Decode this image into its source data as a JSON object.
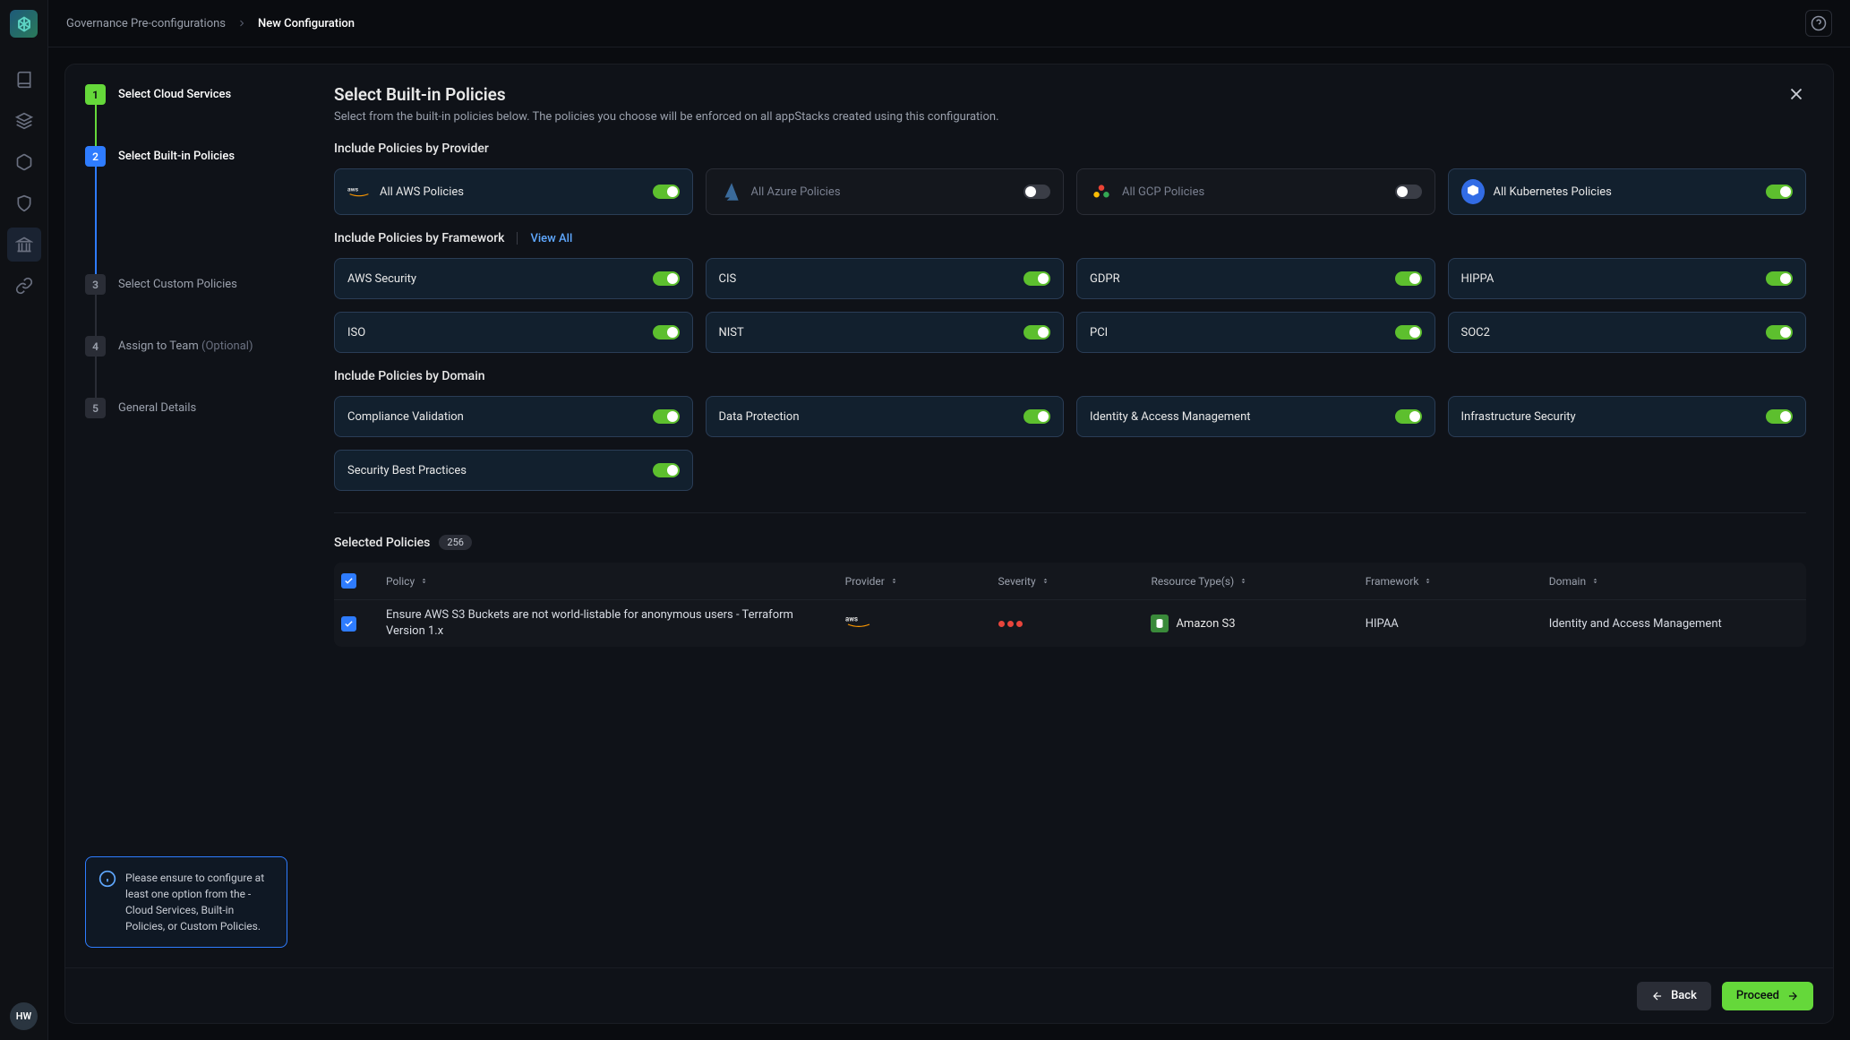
{
  "breadcrumb": {
    "parent": "Governance Pre-configurations",
    "current": "New Configuration"
  },
  "avatar": "HW",
  "steps": [
    {
      "num": "1",
      "label": "Select Cloud Services"
    },
    {
      "num": "2",
      "label": "Select Built-in Policies"
    },
    {
      "num": "3",
      "label": "Select Custom Policies"
    },
    {
      "num": "4",
      "label": "Assign to Team",
      "optional": "(Optional)"
    },
    {
      "num": "5",
      "label": "General Details"
    }
  ],
  "hint": "Please ensure to configure at least one option from the - Cloud Services, Built-in Policies, or Custom Policies.",
  "ws": {
    "title": "Select Built-in Policies",
    "sub": "Select from the built-in policies below. The policies you choose will be enforced on all appStacks created using this configuration."
  },
  "sec_provider": "Include Policies by Provider",
  "sec_framework": "Include Policies by Framework",
  "sec_domain": "Include Policies by Domain",
  "view_all": "View All",
  "providers": [
    {
      "label": "All AWS Policies",
      "on": true,
      "icon": "aws"
    },
    {
      "label": "All Azure Policies",
      "on": false,
      "icon": "azure"
    },
    {
      "label": "All GCP Policies",
      "on": false,
      "icon": "gcp"
    },
    {
      "label": "All Kubernetes Policies",
      "on": true,
      "icon": "k8s"
    }
  ],
  "frameworks": [
    {
      "label": "AWS Security",
      "on": true
    },
    {
      "label": "CIS",
      "on": true
    },
    {
      "label": "GDPR",
      "on": true
    },
    {
      "label": "HIPPA",
      "on": true
    },
    {
      "label": "ISO",
      "on": true
    },
    {
      "label": "NIST",
      "on": true
    },
    {
      "label": "PCI",
      "on": true
    },
    {
      "label": "SOC2",
      "on": true
    }
  ],
  "domains": [
    {
      "label": "Compliance Validation",
      "on": true
    },
    {
      "label": "Data Protection",
      "on": true
    },
    {
      "label": "Identity & Access Management",
      "on": true
    },
    {
      "label": "Infrastructure Security",
      "on": true
    },
    {
      "label": "Security Best Practices",
      "on": true
    }
  ],
  "selected": {
    "title": "Selected Policies",
    "count": "256"
  },
  "columns": {
    "policy": "Policy",
    "provider": "Provider",
    "severity": "Severity",
    "resource": "Resource Type(s)",
    "framework": "Framework",
    "domain": "Domain"
  },
  "rows": [
    {
      "policy": "Ensure AWS S3 Buckets are not world-listable for anonymous users - Terraform Version 1.x",
      "resource": "Amazon S3",
      "framework": "HIPAA",
      "domain": "Identity and Access Management"
    }
  ],
  "buttons": {
    "back": "Back",
    "proceed": "Proceed"
  }
}
